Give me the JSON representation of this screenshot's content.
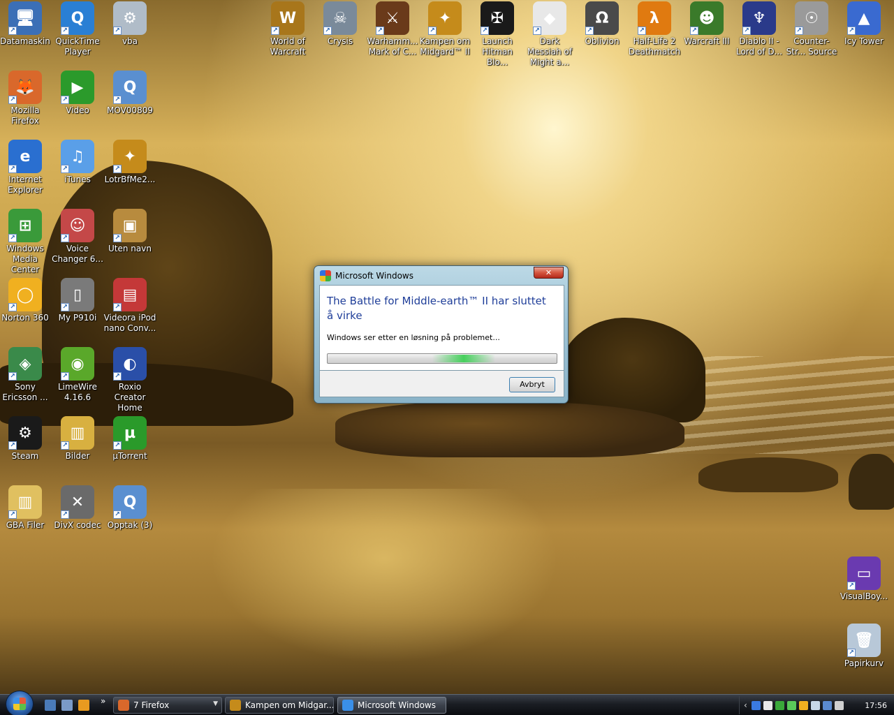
{
  "desktop": {
    "icons_left": [
      {
        "label": "Datamaskin",
        "glyph": "🖥",
        "color": "#3b6fb6"
      },
      {
        "label": "QuickTime Player",
        "glyph": "Q",
        "color": "#2a7fd4"
      },
      {
        "label": "vba",
        "glyph": "⚙",
        "color": "#b0bcc8"
      },
      {
        "label": "Mozilla Firefox",
        "glyph": "🦊",
        "color": "#d9682b"
      },
      {
        "label": "Video",
        "glyph": "▶",
        "color": "#2b9a2b"
      },
      {
        "label": "MOV00809",
        "glyph": "Q",
        "color": "#5a8fd0"
      },
      {
        "label": "Internet Explorer",
        "glyph": "e",
        "color": "#2a6fd0"
      },
      {
        "label": "iTunes",
        "glyph": "♫",
        "color": "#5a9fe8"
      },
      {
        "label": "LotrBfMe2...",
        "glyph": "✦",
        "color": "#c58b1b"
      },
      {
        "label": "Windows Media Center",
        "glyph": "⊞",
        "color": "#3a9a3a"
      },
      {
        "label": "Voice Changer 6...",
        "glyph": "☺",
        "color": "#c44848"
      },
      {
        "label": "Uten navn",
        "glyph": "▣",
        "color": "#b88b3e"
      },
      {
        "label": "Norton 360",
        "glyph": "◯",
        "color": "#f0b020"
      },
      {
        "label": "My P910i",
        "glyph": "▯",
        "color": "#7a7a7a"
      },
      {
        "label": "Videora iPod nano Conv...",
        "glyph": "▤",
        "color": "#c43838"
      },
      {
        "label": "Sony Ericsson ...",
        "glyph": "◈",
        "color": "#3a8a4a"
      },
      {
        "label": "LimeWire 4.16.6",
        "glyph": "◉",
        "color": "#5aa82a"
      },
      {
        "label": "Roxio Creator Home",
        "glyph": "◐",
        "color": "#2a4fa8"
      },
      {
        "label": "Steam",
        "glyph": "⚙",
        "color": "#1a1a1a"
      },
      {
        "label": "Bilder",
        "glyph": "▥",
        "color": "#d8b040"
      },
      {
        "label": "µTorrent",
        "glyph": "µ",
        "color": "#2a9a2a"
      },
      {
        "label": "GBA Filer",
        "glyph": "▥",
        "color": "#e0c060"
      },
      {
        "label": "DivX codec",
        "glyph": "✕",
        "color": "#6a6a6a"
      },
      {
        "label": "Opptak (3)",
        "glyph": "Q",
        "color": "#5a8fd0"
      }
    ],
    "icons_top": [
      {
        "label": "World of Warcraft",
        "glyph": "W",
        "color": "#a8761b"
      },
      {
        "label": "Crysis",
        "glyph": "☠",
        "color": "#7a8a9a"
      },
      {
        "label": "Warhamm... Mark of C...",
        "glyph": "⚔",
        "color": "#6a3a1a"
      },
      {
        "label": "Kampen om Midgard™ II",
        "glyph": "✦",
        "color": "#c58b1b"
      },
      {
        "label": "Launch Hitman Blo...",
        "glyph": "✠",
        "color": "#1a1a1a"
      },
      {
        "label": "Dark Messiah of Might a...",
        "glyph": "◆",
        "color": "#e8e8e8"
      },
      {
        "label": "Oblivion",
        "glyph": "Ω",
        "color": "#4a4a4a"
      },
      {
        "label": "Half-Life 2 Deathmatch",
        "glyph": "λ",
        "color": "#e07a10"
      },
      {
        "label": "Warcraft III",
        "glyph": "☻",
        "color": "#3a7a2a"
      },
      {
        "label": "Diablo II - Lord of D...",
        "glyph": "♆",
        "color": "#2a3a8a"
      },
      {
        "label": "Counter-Str... Source",
        "glyph": "☉",
        "color": "#9a9a9a"
      },
      {
        "label": "Icy Tower",
        "glyph": "▲",
        "color": "#3a6ad0"
      }
    ],
    "icons_right": [
      {
        "label": "VisualBoy...",
        "glyph": "▭",
        "color": "#6a3ab0"
      },
      {
        "label": "Papirkurv",
        "glyph": "🗑",
        "color": "#b8c8d8"
      }
    ]
  },
  "dialog": {
    "window_title": "Microsoft Windows",
    "close_glyph": "✕",
    "heading": "The Battle for Middle-earth™ II har sluttet å virke",
    "message": "Windows ser etter en løsning på problemet...",
    "cancel_label": "Avbryt",
    "progress_indeterminate": true
  },
  "taskbar": {
    "quicklaunch_more": "»",
    "tasks": [
      {
        "label": "7 Firefox",
        "color": "#d9682b",
        "has_dropdown": true,
        "dropdown_glyph": "▼"
      },
      {
        "label": "Kampen om Midgar...",
        "color": "#c58b1b",
        "has_dropdown": false
      },
      {
        "label": "Microsoft Windows",
        "color": "#3a8fe8",
        "has_dropdown": false,
        "active": true
      }
    ],
    "tray_chevron": "‹",
    "clock": "17:56"
  }
}
